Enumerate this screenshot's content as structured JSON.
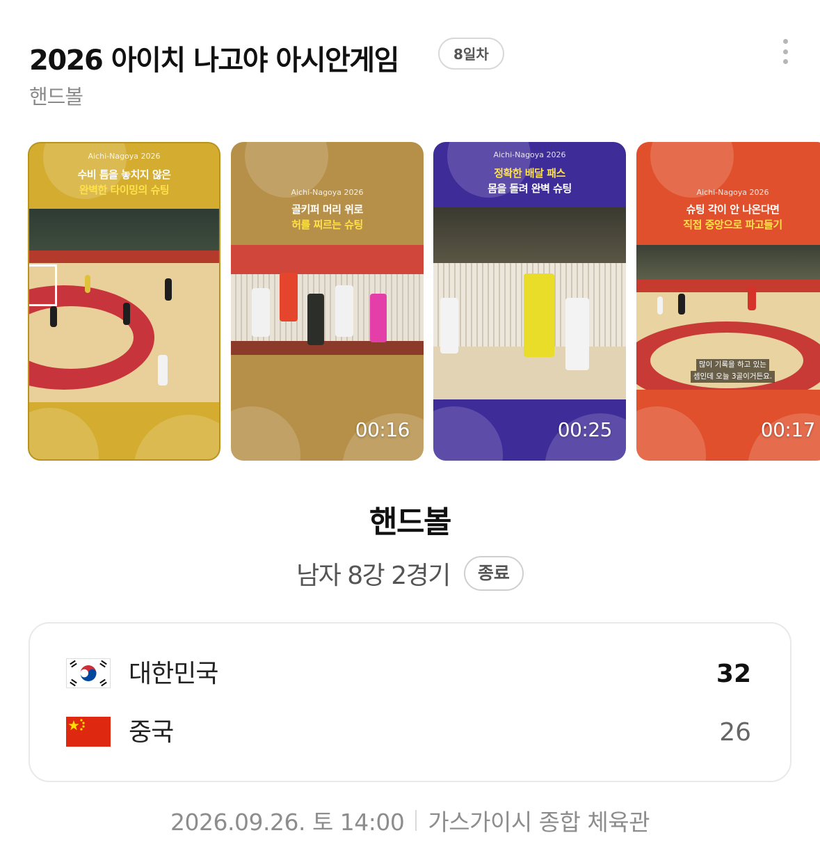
{
  "header": {
    "title": "2026 아이치 나고야 아시안게임",
    "day_badge": "8일차",
    "subtitle": "핸드볼"
  },
  "shorts": [
    {
      "brand": "Aichi-Nagoya 2026",
      "caption_line1": "수비 틈을 놓치지 않은",
      "caption_line2": "완벽한 타이밍의 슈팅",
      "duration": "",
      "theme_color": "#d2ab2f"
    },
    {
      "brand": "Aichi-Nagoya 2026",
      "caption_line1": "골키퍼 머리 위로",
      "caption_line2": "허를 찌르는 슈팅",
      "duration": "00:16",
      "theme_color": "#b58f49"
    },
    {
      "brand": "Aichi-Nagoya 2026",
      "caption_line1": "정확한 배달 패스",
      "caption_line2": "몸을 돌려 완벽 슈팅",
      "duration": "00:25",
      "theme_color": "#3d2c97"
    },
    {
      "brand": "Aichi-Nagoya 2026",
      "caption_line1": "슈팅 각이 안 나온다면",
      "caption_line2": "직접 중앙으로 파고들기",
      "subtitle_line1": "많이 기록을 하고 있는",
      "subtitle_line2": "셈인데 오늘 3골이거든요.",
      "duration": "00:17",
      "theme_color": "#e0502c"
    }
  ],
  "match": {
    "sport": "핸드볼",
    "name": "남자 8강 2경기",
    "status": "종료"
  },
  "scoreboard": {
    "teams": [
      {
        "name": "대한민국",
        "score": "32",
        "flag_icon": "korea-flag-icon",
        "winner": true
      },
      {
        "name": "중국",
        "score": "26",
        "flag_icon": "china-flag-icon",
        "winner": false
      }
    ]
  },
  "footer": {
    "datetime": "2026.09.26. 토 14:00",
    "venue": "가스가이시 종합 체육관"
  }
}
